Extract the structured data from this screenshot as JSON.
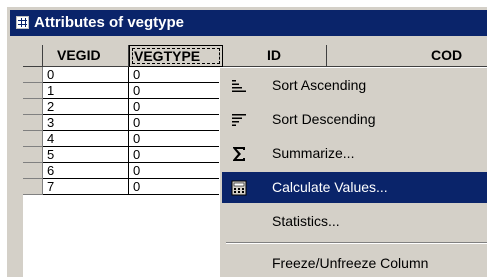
{
  "window": {
    "title": "Attributes of vegtype"
  },
  "table": {
    "columns": [
      "VEGID",
      "VEGTYPE",
      "ID",
      "COD"
    ],
    "rows": [
      [
        "0",
        "0"
      ],
      [
        "1",
        "0"
      ],
      [
        "2",
        "0"
      ],
      [
        "3",
        "0"
      ],
      [
        "4",
        "0"
      ],
      [
        "5",
        "0"
      ],
      [
        "6",
        "0"
      ],
      [
        "7",
        "0"
      ]
    ]
  },
  "context_menu": {
    "items": [
      {
        "label": "Sort Ascending",
        "icon": "sort-ascending-icon"
      },
      {
        "label": "Sort Descending",
        "icon": "sort-descending-icon"
      },
      {
        "label": "Summarize...",
        "icon": "sigma-icon"
      },
      {
        "label": "Calculate Values...",
        "icon": "calculator-icon",
        "highlighted": true
      },
      {
        "label": "Statistics...",
        "icon": ""
      },
      {
        "label": "Freeze/Unfreeze Column",
        "icon": ""
      }
    ]
  },
  "colors": {
    "title_bg": "#0a246a",
    "highlight": "#0a246a",
    "face": "#d4d0c8"
  }
}
